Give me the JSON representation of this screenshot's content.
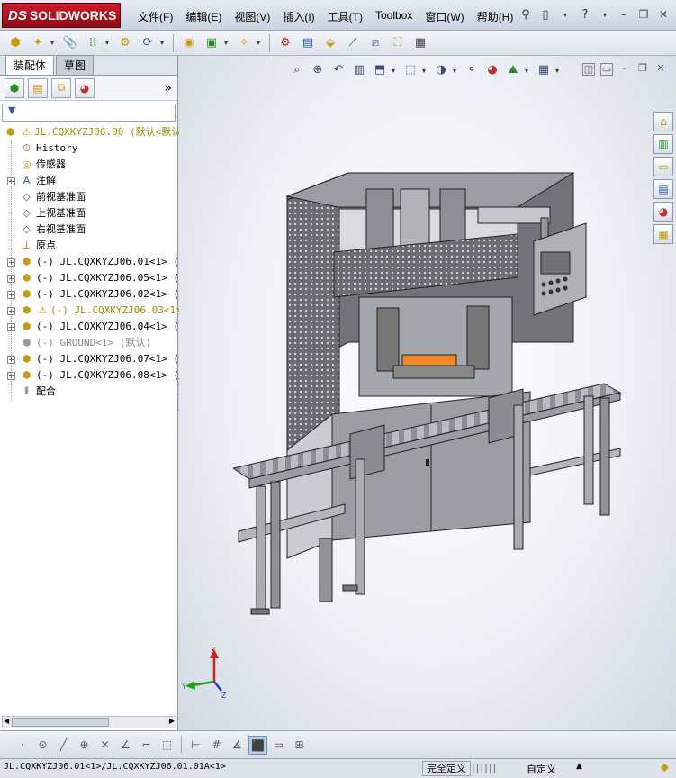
{
  "app": {
    "brand": "SOLIDWORKS",
    "brand_prefix": "DS"
  },
  "menu": [
    "文件(F)",
    "编辑(E)",
    "视图(V)",
    "插入(I)",
    "工具(T)",
    "Toolbox",
    "窗口(W)",
    "帮助(H)"
  ],
  "panel": {
    "tabs": [
      "装配体",
      "草图"
    ],
    "filter_icon": "funnel-icon",
    "expand_label": "»"
  },
  "tree": [
    {
      "level": 0,
      "expander": "",
      "icon": "assembly-icon",
      "warn": true,
      "text": "JL.CQXKYZJ06.00  (默认<默认",
      "style": "warn"
    },
    {
      "level": 1,
      "expander": "",
      "icon": "history-icon",
      "text": "History",
      "style": ""
    },
    {
      "level": 1,
      "expander": "",
      "icon": "sensor-icon",
      "text": "传感器",
      "style": ""
    },
    {
      "level": 1,
      "expander": "+",
      "icon": "annotation-icon",
      "text": "注解",
      "style": ""
    },
    {
      "level": 1,
      "expander": "",
      "icon": "plane-icon",
      "text": "前视基准面",
      "style": ""
    },
    {
      "level": 1,
      "expander": "",
      "icon": "plane-icon",
      "text": "上视基准面",
      "style": ""
    },
    {
      "level": 1,
      "expander": "",
      "icon": "plane-icon",
      "text": "右视基准面",
      "style": ""
    },
    {
      "level": 1,
      "expander": "",
      "icon": "origin-icon",
      "text": "原点",
      "style": ""
    },
    {
      "level": 1,
      "expander": "+",
      "icon": "assembly-icon",
      "text": "(-) JL.CQXKYZJ06.01<1> (默",
      "style": ""
    },
    {
      "level": 1,
      "expander": "+",
      "icon": "assembly-icon",
      "text": "(-) JL.CQXKYZJ06.05<1> (默",
      "style": ""
    },
    {
      "level": 1,
      "expander": "+",
      "icon": "assembly-icon",
      "text": "(-) JL.CQXKYZJ06.02<1> (默",
      "style": ""
    },
    {
      "level": 1,
      "expander": "+",
      "icon": "assembly-icon",
      "warn": true,
      "text": "(-) JL.CQXKYZJ06.03<1>",
      "style": "warn"
    },
    {
      "level": 1,
      "expander": "+",
      "icon": "assembly-icon",
      "text": "(-) JL.CQXKYZJ06.04<1> (默",
      "style": ""
    },
    {
      "level": 1,
      "expander": "",
      "icon": "part-icon",
      "text": "(-) GROUND<1> (默认)",
      "style": "dim"
    },
    {
      "level": 1,
      "expander": "+",
      "icon": "assembly-icon",
      "text": "(-) JL.CQXKYZJ06.07<1> (默",
      "style": ""
    },
    {
      "level": 1,
      "expander": "+",
      "icon": "assembly-icon",
      "text": "(-) JL.CQXKYZJ06.08<1> (默",
      "style": ""
    },
    {
      "level": 1,
      "expander": "",
      "icon": "mates-icon",
      "text": "配合",
      "style": ""
    }
  ],
  "triad": {
    "x": "X",
    "y": "Y",
    "z": "Z"
  },
  "status": {
    "path": "JL.CQXKYZJ06.01<1>/JL.CQXKYZJ06.01.01A<1>",
    "definition": "完全定义",
    "units": "自定义",
    "caret": "▲"
  }
}
